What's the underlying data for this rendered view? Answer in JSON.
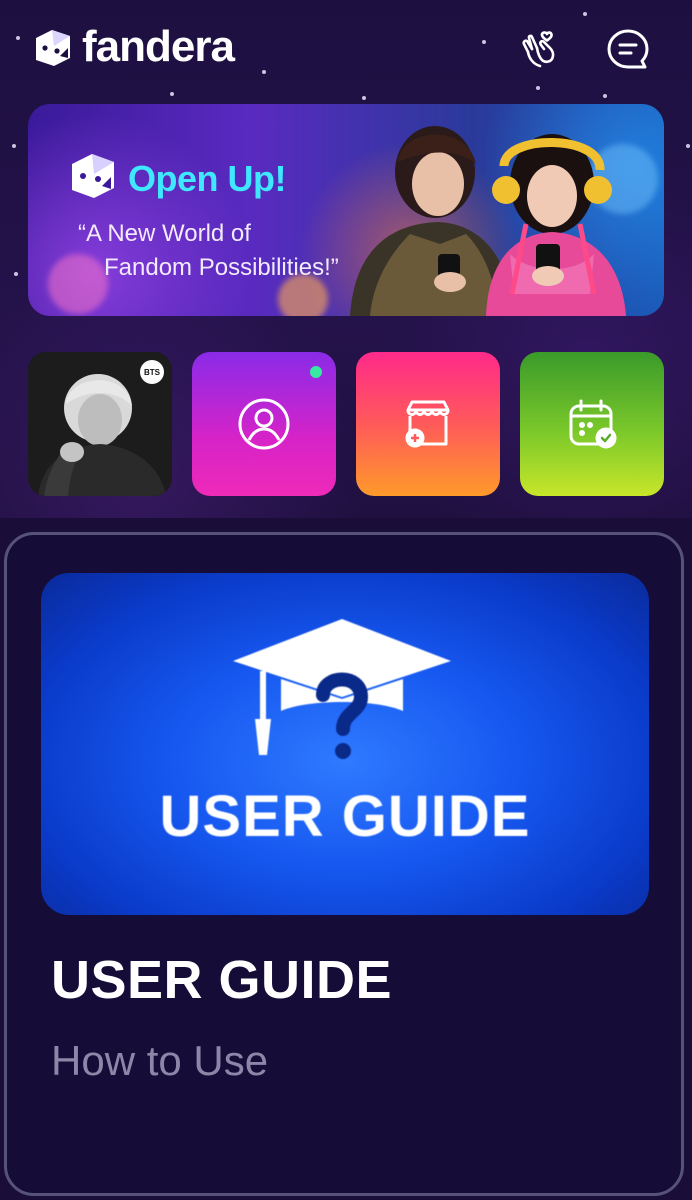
{
  "header": {
    "brand": "fandera",
    "icons": [
      "fandera-logo-icon",
      "finger-heart-icon",
      "chat-icon"
    ]
  },
  "banner": {
    "title": "Open Up!",
    "quote_line1": "“A New World of",
    "quote_line2": "Fandom Possibilities!”",
    "icons": [
      "mascot-icon"
    ]
  },
  "tiles": [
    {
      "name": "artist",
      "badge": "BTS"
    },
    {
      "name": "profile",
      "icon": "user-circle-icon"
    },
    {
      "name": "shop",
      "icon": "store-icon"
    },
    {
      "name": "calendar",
      "icon": "calendar-check-icon"
    }
  ],
  "guide_card": {
    "image_text": "USER GUIDE",
    "title": "USER GUIDE",
    "subtitle": "How to Use",
    "icons": [
      "graduation-cap-question-icon"
    ]
  },
  "colors": {
    "background": "#1a0e38",
    "banner_accent": "#3fe7ff",
    "card_border": "#57527a",
    "online": "#38e8a0"
  }
}
